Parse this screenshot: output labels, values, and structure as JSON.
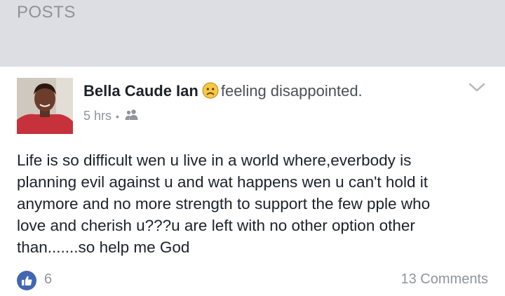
{
  "section": {
    "title": "POSTS"
  },
  "post": {
    "author": "Bella Caude Ian",
    "feeling_icon": "sad-face-emoji",
    "feeling": "feeling disappointed.",
    "time": "5 hrs",
    "audience_icon": "friends-icon",
    "lines": [
      "Life is so difficult wen u live in a world where,everbody is",
      "planning evil against u and wat happens wen u can't hold it",
      "anymore and no more strength to support the few pple who",
      "love and cherish u???u are left with no other option other",
      "than.......so help me God"
    ],
    "likes": "6",
    "comments": "13 Comments"
  },
  "colors": {
    "like_blue": "#4267b2",
    "background": "#dcdee3",
    "card": "#ffffff"
  }
}
